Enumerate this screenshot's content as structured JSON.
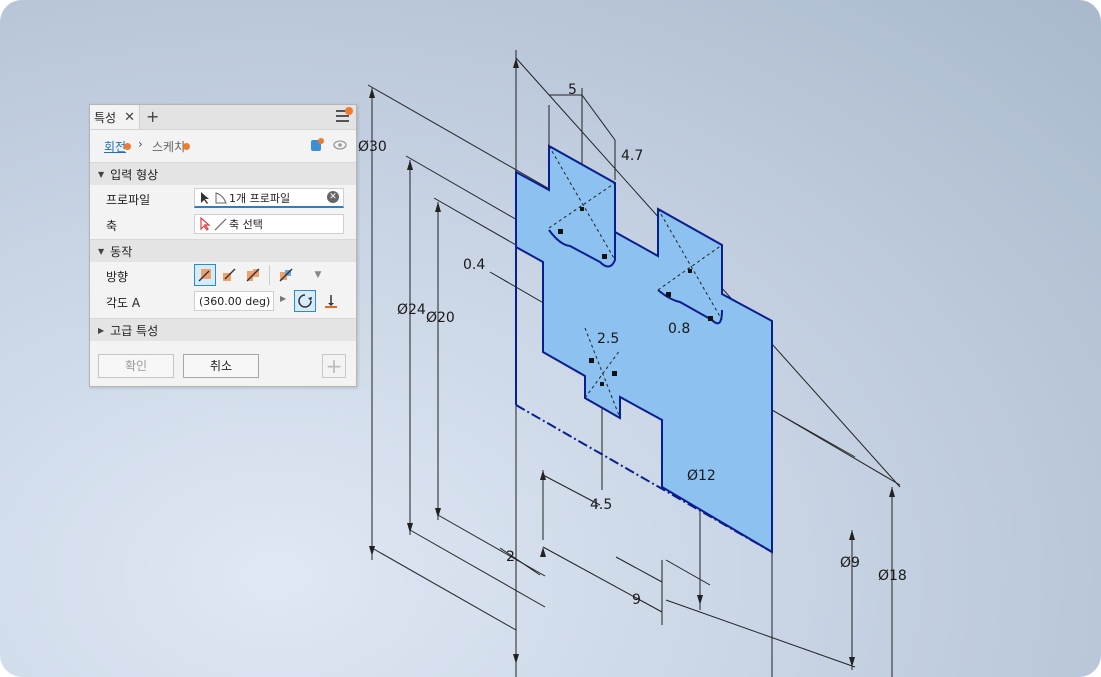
{
  "panel": {
    "tab_title": "특성",
    "tab_close": "✕",
    "tab_add": "+",
    "breadcrumb": {
      "item1": "회전",
      "separator": "›",
      "item2": "스케치"
    },
    "sections": {
      "input_geometry": "입력 형상",
      "behavior": "동작",
      "advanced": "고급 특성"
    },
    "profile": {
      "label": "프로파일",
      "value": "1개 프로파일"
    },
    "axis": {
      "label": "축",
      "value": "축 선택"
    },
    "direction": {
      "label": "방향"
    },
    "angle": {
      "label": "각도 A",
      "value": "(360.00 deg)"
    },
    "buttons": {
      "ok": "확인",
      "cancel": "취소",
      "add": "+"
    }
  },
  "dimensions": {
    "d5": "5",
    "d47": "4.7",
    "d30": "Ø30",
    "d04": "0.4",
    "d24": "Ø24",
    "d20": "Ø20",
    "d08": "0.8",
    "d25": "2.5",
    "d12": "Ø12",
    "d45": "4.5",
    "d2": "2",
    "d9": "9",
    "dphi9": "Ø9",
    "dphi18": "Ø18"
  },
  "colors": {
    "profile_fill": "#8dc1f0",
    "profile_edge": "#0a1f8f",
    "accent": "#f07a2c",
    "link": "#1f6fbf"
  }
}
